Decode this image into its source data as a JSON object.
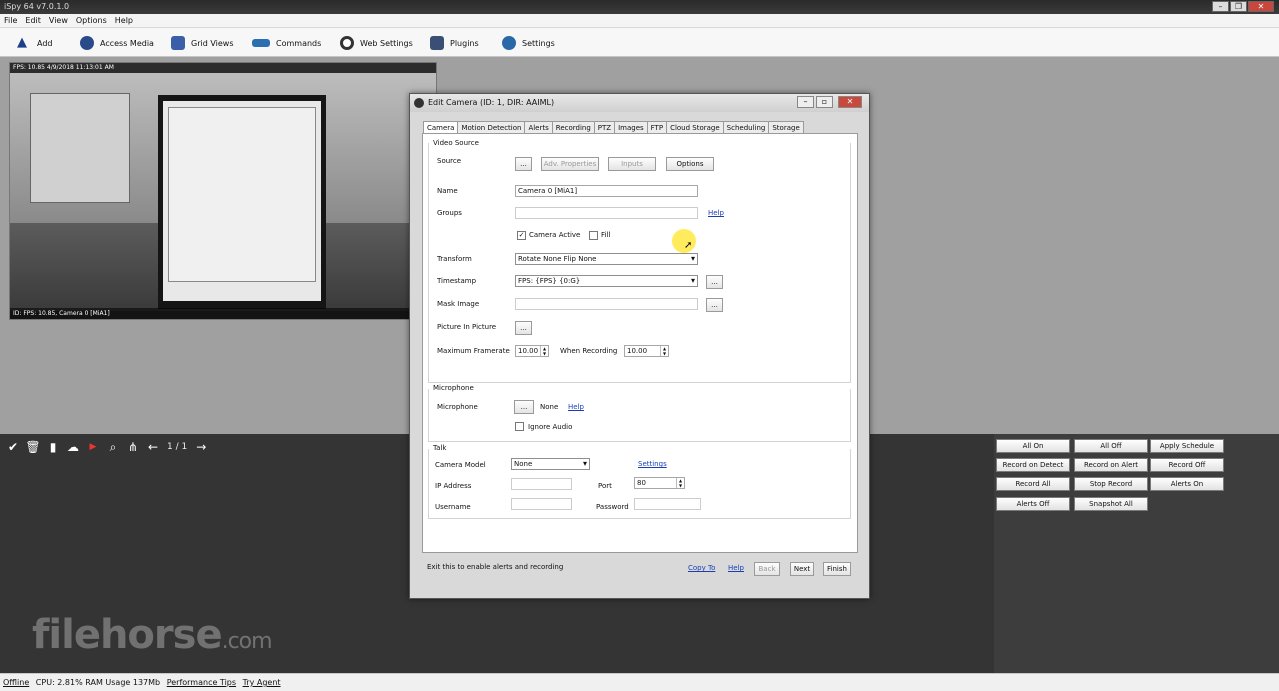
{
  "window": {
    "title": "iSpy 64 v7.0.1.0"
  },
  "menu": [
    "File",
    "Edit",
    "View",
    "Options",
    "Help"
  ],
  "toolbar": {
    "add": "Add",
    "access_media": "Access Media",
    "grid_views": "Grid Views",
    "commands": "Commands",
    "web_settings": "Web Settings",
    "plugins": "Plugins",
    "settings": "Settings"
  },
  "camera_tile": {
    "overlay_top": "FPS: 10.85 4/9/2018 11:13:01 AM",
    "overlay_bottom": "ID: FPS: 10.85, Camera 0 [MiA1]"
  },
  "pager": {
    "text": "1 / 1"
  },
  "command_buttons": {
    "all_on": "All On",
    "all_off": "All Off",
    "apply_schedule": "Apply Schedule",
    "record_on_detect": "Record on Detect",
    "record_on_alert": "Record on Alert",
    "record_off": "Record Off",
    "record_all": "Record All",
    "stop_record": "Stop Record",
    "alerts_on": "Alerts On",
    "alerts_off": "Alerts Off",
    "snapshot_all": "Snapshot All"
  },
  "watermark": {
    "main": "filehorse",
    "suffix": ".com"
  },
  "status": {
    "offline": "Offline",
    "usage": "CPU: 2.81% RAM Usage 137Mb",
    "performance_tips": "Performance Tips",
    "try_agent": "Try Agent"
  },
  "dialog": {
    "title": "Edit Camera (ID: 1, DIR: AAIML)",
    "tabs": [
      "Camera",
      "Motion Detection",
      "Alerts",
      "Recording",
      "PTZ",
      "Images",
      "FTP",
      "Cloud Storage",
      "Scheduling",
      "Storage"
    ],
    "video_source": {
      "legend": "Video Source",
      "source_label": "Source",
      "browse": "...",
      "adv_properties": "Adv. Properties",
      "inputs": "Inputs",
      "options": "Options",
      "name_label": "Name",
      "name_value": "Camera 0 [MiA1]",
      "groups_label": "Groups",
      "groups_value": "",
      "help": "Help",
      "camera_active": "Camera Active",
      "fill": "Fill",
      "transform_label": "Transform",
      "transform_value": "Rotate None Flip None",
      "timestamp_label": "Timestamp",
      "timestamp_value": "FPS: {FPS} {0:G}",
      "timestamp_btn": "...",
      "mask_label": "Mask Image",
      "mask_btn": "...",
      "pip_label": "Picture In Picture",
      "pip_btn": "...",
      "max_framerate_label": "Maximum Framerate",
      "max_framerate_value": "10.00",
      "when_recording_label": "When Recording",
      "when_recording_value": "10.00"
    },
    "microphone": {
      "legend": "Microphone",
      "label": "Microphone",
      "btn": "...",
      "value": "None",
      "help": "Help",
      "ignore_audio": "Ignore Audio"
    },
    "talk": {
      "legend": "Talk",
      "camera_model_label": "Camera Model",
      "camera_model_value": "None",
      "settings": "Settings",
      "ip_label": "IP Address",
      "port_label": "Port",
      "port_value": "80",
      "username_label": "Username",
      "password_label": "Password"
    },
    "footer": {
      "hint": "Exit this to enable alerts and recording",
      "copy_to": "Copy To",
      "help": "Help",
      "back": "Back",
      "next": "Next",
      "finish": "Finish"
    }
  }
}
